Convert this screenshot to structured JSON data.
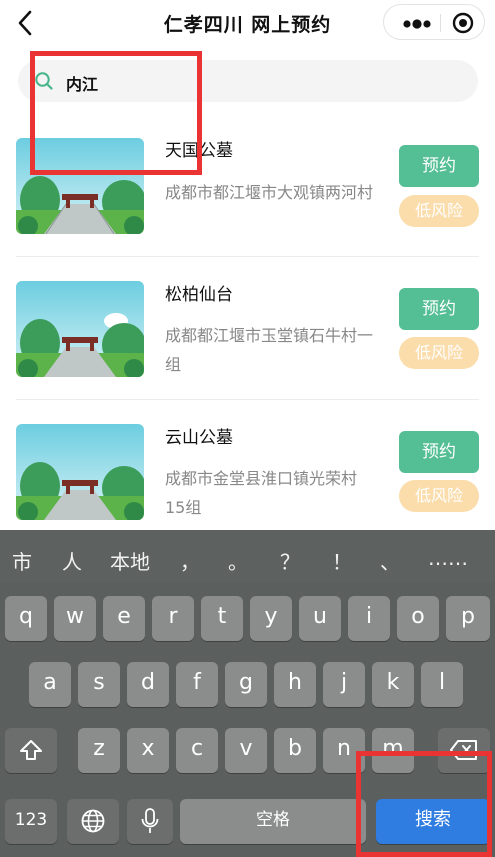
{
  "nav": {
    "title": "仁孝四川 网上预约",
    "back_icon": "chevron-left-icon",
    "more_icon": "more-dots-icon",
    "close_icon": "target-circle-icon"
  },
  "search": {
    "value": "内江",
    "icon": "search-icon"
  },
  "results": [
    {
      "name": "天国公墓",
      "address": "成都市都江堰市大观镇两河村",
      "book_label": "预约",
      "risk_label": "低风险"
    },
    {
      "name": "松柏仙台",
      "address": "成都都江堰市玉堂镇石牛村一组",
      "book_label": "预约",
      "risk_label": "低风险"
    },
    {
      "name": "云山公墓",
      "address": "成都市金堂县淮口镇光荣村15组",
      "book_label": "预约",
      "risk_label": "低风险"
    }
  ],
  "keyboard": {
    "candidates": [
      "市",
      "人",
      "本地",
      "，",
      "。",
      "？",
      "！",
      "、",
      "……"
    ],
    "row1": [
      "q",
      "w",
      "e",
      "r",
      "t",
      "y",
      "u",
      "i",
      "o",
      "p"
    ],
    "row2": [
      "a",
      "s",
      "d",
      "f",
      "g",
      "h",
      "j",
      "k",
      "l"
    ],
    "row3": [
      "z",
      "x",
      "c",
      "v",
      "b",
      "n",
      "m"
    ],
    "num_label": "123",
    "space_label": "空格",
    "search_label": "搜索",
    "shift_icon": "shift-icon",
    "delete_icon": "delete-icon",
    "globe_icon": "globe-icon",
    "mic_icon": "microphone-icon"
  },
  "colors": {
    "book_button": "#54be94",
    "risk_badge": "#fbdcab",
    "search_key": "#2f7de1",
    "annotation": "#ea3333"
  }
}
